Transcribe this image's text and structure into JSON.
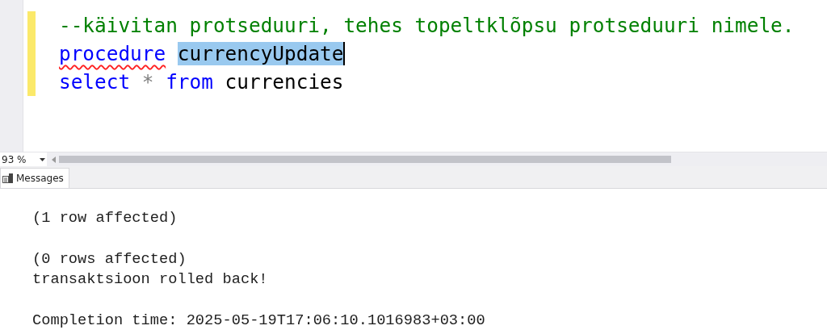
{
  "editor": {
    "lines": [
      {
        "changed": true,
        "tokens": [
          {
            "kind": "comment",
            "text": "--käivitan protseduuri, tehes topeltklõpsu protseduuri nimele.",
            "selected": false,
            "squiggle": false
          }
        ]
      },
      {
        "changed": true,
        "tokens": [
          {
            "kind": "keyword",
            "text": "procedure",
            "selected": false,
            "squiggle": true
          },
          {
            "kind": "identifier",
            "text": "currencyUpdate",
            "selected": true,
            "squiggle": false
          }
        ]
      },
      {
        "changed": true,
        "tokens": [
          {
            "kind": "keyword",
            "text": "select",
            "selected": false,
            "squiggle": false
          },
          {
            "kind": "operator",
            "text": "*",
            "selected": false,
            "squiggle": false
          },
          {
            "kind": "keyword",
            "text": "from",
            "selected": false,
            "squiggle": false
          },
          {
            "kind": "identifier",
            "text": "currencies",
            "selected": false,
            "squiggle": false
          }
        ]
      }
    ],
    "caret_after_selection": true
  },
  "zoom": {
    "value": "93 %"
  },
  "tabs": [
    {
      "label": "Messages",
      "selected": true
    }
  ],
  "messages": {
    "blocks": [
      [
        "(1 row affected)"
      ],
      [
        "(0 rows affected)",
        "transaktsioon rolled back!"
      ],
      [
        "Completion time: 2025-05-19T17:06:10.1016983+03:00"
      ]
    ]
  }
}
